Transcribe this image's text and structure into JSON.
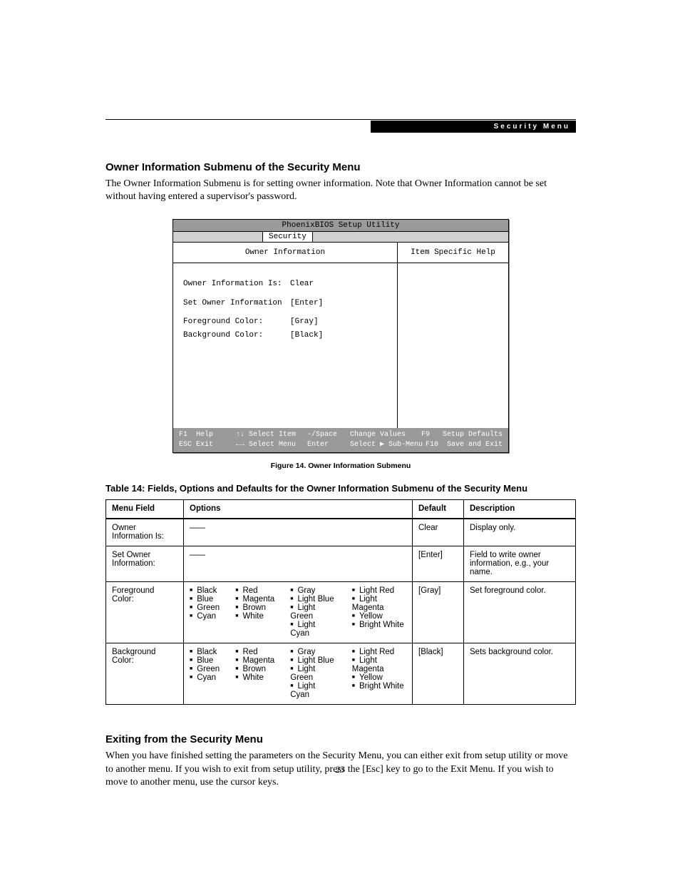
{
  "header": {
    "label": "Security Menu"
  },
  "section1": {
    "title": "Owner Information Submenu of the Security Menu",
    "body": "The Owner Information Submenu is for setting owner information. Note that Owner Information cannot be set without having entered a supervisor's password."
  },
  "bios": {
    "title": "PhoenixBIOS Setup Utility",
    "tab": "Security",
    "left_title": "Owner Information",
    "right_title": "Item Specific Help",
    "rows": [
      {
        "label": "Owner Information Is:",
        "value": "Clear"
      },
      {
        "label": "Set Owner Information",
        "value": "[Enter]"
      },
      {
        "label": "Foreground Color:",
        "value": "[Gray]"
      },
      {
        "label": "Background Color:",
        "value": "[Black]"
      }
    ],
    "footer": {
      "r1": {
        "k1": "F1",
        "v1": "Help",
        "k2": "↑↓",
        "v2": "Select Item",
        "k3": "-/Space",
        "v3": "Change Values",
        "k4": "F9",
        "v4": "Setup Defaults"
      },
      "r2": {
        "k1": "ESC",
        "v1": "Exit",
        "k2": "←→",
        "v2": "Select Menu",
        "k3": "Enter",
        "v3": "Select ▶ Sub-Menu",
        "k4": "F10",
        "v4": "Save and Exit"
      }
    }
  },
  "figure": {
    "caption": "Figure 14.   Owner Information Submenu"
  },
  "table": {
    "title": "Table 14: Fields, Options and Defaults for the Owner Information Submenu of the Security Menu",
    "headers": {
      "menu": "Menu Field",
      "options": "Options",
      "default": "Default",
      "desc": "Description"
    },
    "rows": [
      {
        "menu": "Owner Information Is:",
        "options_dash": "——",
        "default": "Clear",
        "desc": "Display only."
      },
      {
        "menu": "Set Owner Information:",
        "options_dash": "——",
        "default": "[Enter]",
        "desc": "Field to write owner information, e.g., your name."
      },
      {
        "menu": "Foreground Color:",
        "colors": true,
        "default": "[Gray]",
        "desc": "Set foreground color."
      },
      {
        "menu": "Background Color:",
        "colors": true,
        "default": "[Black]",
        "desc": "Sets background color."
      }
    ],
    "color_columns": [
      [
        "Black",
        "Blue",
        "Green",
        "Cyan"
      ],
      [
        "Red",
        "Magenta",
        "Brown",
        "White"
      ],
      [
        "Gray",
        "Light Blue",
        "Light Green",
        "Light Cyan"
      ],
      [
        "Light Red",
        "Light Magenta",
        "Yellow",
        "Bright White"
      ]
    ]
  },
  "section2": {
    "title": "Exiting from the Security Menu",
    "body": "When you have finished setting the parameters on the Security Menu, you can either exit from setup utility or move to another menu. If you wish to exit from setup utility, press the [Esc] key to go to the Exit Menu. If you wish to move to another menu, use the cursor keys."
  },
  "page_number": "23"
}
